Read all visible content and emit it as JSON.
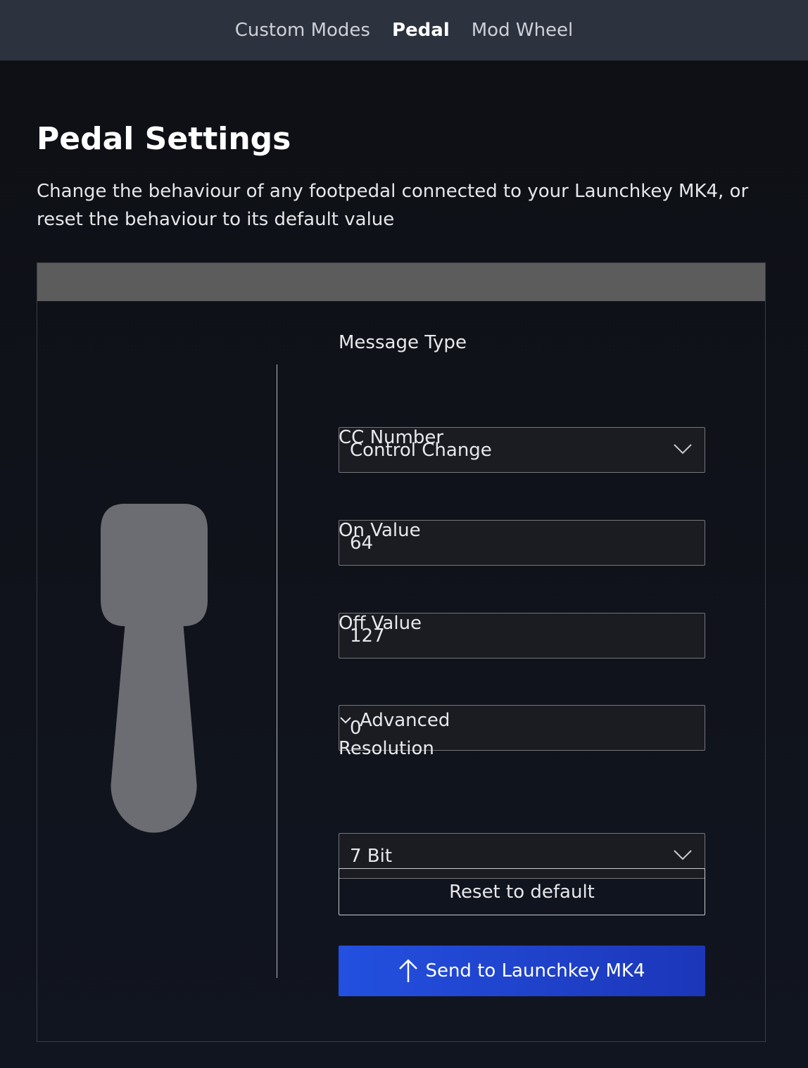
{
  "nav": {
    "tabs": [
      {
        "label": "Custom Modes",
        "active": false
      },
      {
        "label": "Pedal",
        "active": true
      },
      {
        "label": "Mod Wheel",
        "active": false
      }
    ]
  },
  "page": {
    "title": "Pedal Settings",
    "description": "Change the behaviour of any footpedal connected to your Launchkey MK4, or reset the behaviour to its default value"
  },
  "form": {
    "message_type": {
      "label": "Message Type",
      "value": "Control Change"
    },
    "cc_number": {
      "label": "CC Number",
      "value": "64"
    },
    "on_value": {
      "label": "On Value",
      "value": "127"
    },
    "off_value": {
      "label": "Off Value",
      "value": "0"
    },
    "advanced_label": "Advanced",
    "resolution": {
      "label": "Resolution",
      "value": "7 Bit"
    },
    "reset_label": "Reset to default",
    "send_label": "Send to Launchkey MK4"
  },
  "colors": {
    "accent": "#2350e0",
    "nav_bg": "#2d323f",
    "panel_header": "#5c5c5c",
    "pedal": "#6b6d72"
  }
}
